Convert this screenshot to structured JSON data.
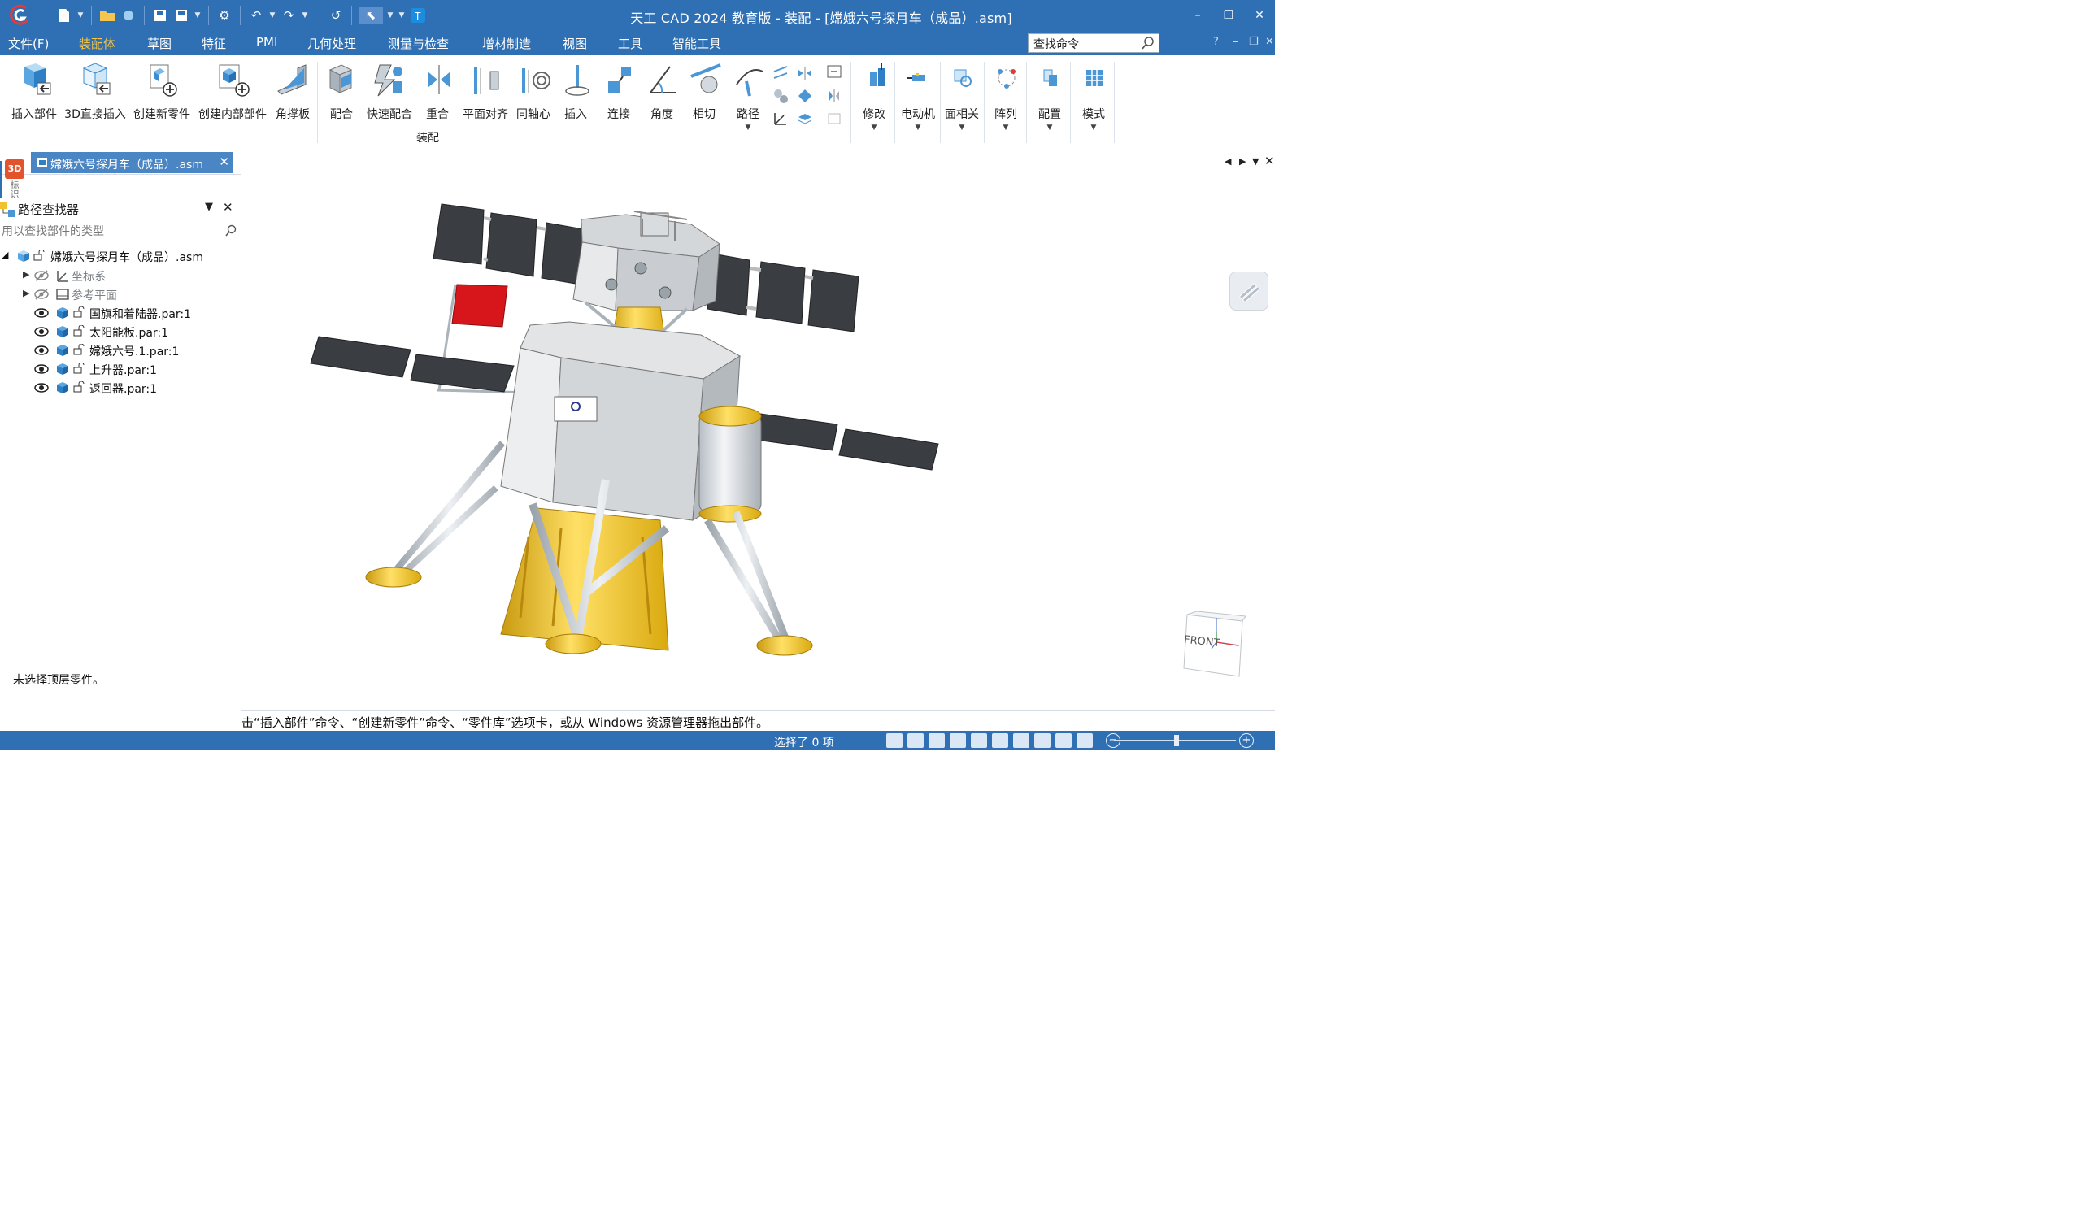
{
  "app": {
    "window_title": "天工 CAD 2024 教育版 - 装配 - [嫦娥六号探月车（成品）.asm]"
  },
  "window_controls": {
    "minimize": "–",
    "restore": "❐",
    "close": "✕"
  },
  "menu": {
    "items": [
      "文件(F)",
      "装配体",
      "草图",
      "特征",
      "PMI",
      "几何处理",
      "测量与检查",
      "增材制造",
      "视图",
      "工具",
      "智能工具"
    ],
    "active_index": 1
  },
  "search": {
    "value": "查找命令"
  },
  "mdi_controls": {
    "help": "?",
    "minimize": "–",
    "restore": "❐",
    "close": "✕"
  },
  "ribbon": {
    "buttons": {
      "insert_part": "插入部件",
      "direct_insert_3d": "3D直接插入",
      "create_new_part": "创建新零件",
      "create_internal_part": "创建内部部件",
      "gusset": "角撑板",
      "mate": "配合",
      "quick_mate": "快速配合",
      "coincident": "重合",
      "plane_align": "平面对齐",
      "concentric": "同轴心",
      "insert": "插入",
      "connect": "连接",
      "angle": "角度",
      "tangent": "相切",
      "path": "路径",
      "modify": "修改",
      "motor": "电动机",
      "face_relate": "面相关",
      "pattern": "阵列",
      "configure": "配置",
      "mode": "模式"
    },
    "group_label": "装配"
  },
  "document_tab": {
    "title": "嫦娥六号探月车（成品）.asm",
    "close": "✕"
  },
  "side_strip": {
    "badge": "3D",
    "label": "标识"
  },
  "path_finder": {
    "title": "路径查找器",
    "filter_placeholder": "用以查找部件的类型",
    "root": "嫦娥六号探月车（成品）.asm",
    "nodes": [
      {
        "label": "坐标系",
        "dim": true,
        "expandable": true
      },
      {
        "label": "参考平面",
        "dim": true,
        "expandable": true
      },
      {
        "label": "国旗和着陆器.par:1",
        "dim": false,
        "expandable": false
      },
      {
        "label": "太阳能板.par:1",
        "dim": false,
        "expandable": false
      },
      {
        "label": "嫦娥六号.1.par:1",
        "dim": false,
        "expandable": false
      },
      {
        "label": "上升器.par:1",
        "dim": false,
        "expandable": false
      },
      {
        "label": "返回器.par:1",
        "dim": false,
        "expandable": false
      }
    ],
    "status": "未选择顶层零件。"
  },
  "viewport": {
    "view_cube_label": "FRONT"
  },
  "prompt": {
    "text": "击“插入部件”命令、“创建新零件”命令、“零件库”选项卡，或从 Windows 资源管理器拖出部件。"
  },
  "statusbar": {
    "selection": "选择了 0 项",
    "zoom_out": "−",
    "zoom_in": "+"
  },
  "colors": {
    "titlebar": "#2f6fb3",
    "accent": "#f9c542",
    "panel_blue": "#3e7fc1",
    "gold": "#f2c12e"
  }
}
